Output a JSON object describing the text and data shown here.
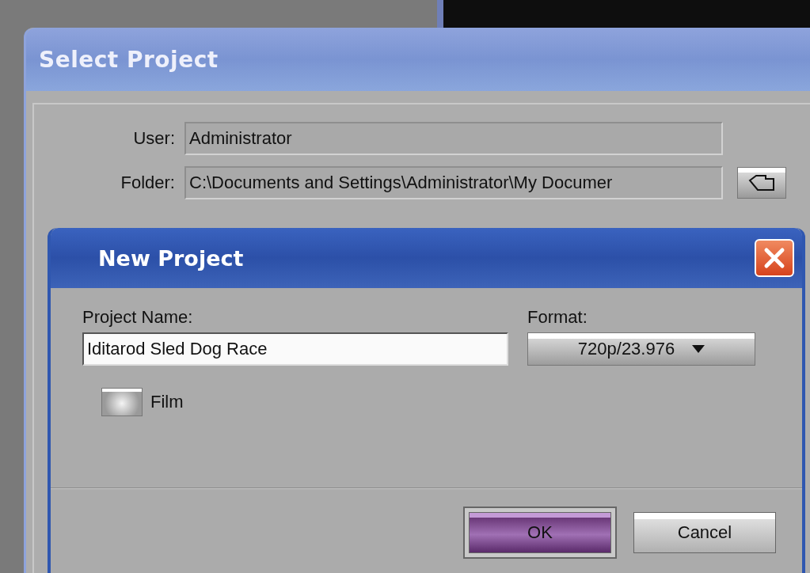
{
  "select_project": {
    "title": "Select Project",
    "fields": [
      {
        "label": "User:",
        "value": "Administrator"
      },
      {
        "label": "Folder:",
        "value": "C:\\Documents and Settings\\Administrator\\My Documer"
      }
    ]
  },
  "new_project": {
    "title": "New Project",
    "project_name": {
      "label": "Project Name:",
      "value": "Iditarod Sled Dog Race"
    },
    "format": {
      "label": "Format:",
      "value": "720p/23.976"
    },
    "film": {
      "label": "Film",
      "checked": false
    },
    "buttons": [
      {
        "label": "OK",
        "default": true
      },
      {
        "label": "Cancel",
        "default": false
      }
    ]
  }
}
